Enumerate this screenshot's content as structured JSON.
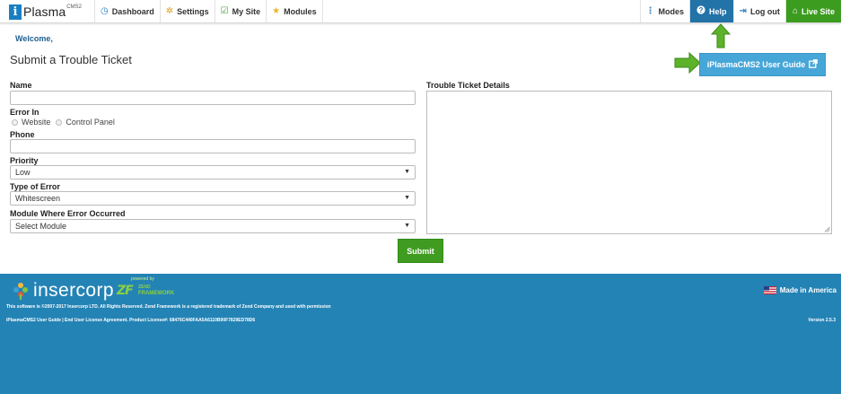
{
  "nav": {
    "brand_letter": "i",
    "brand_name": "Plasma",
    "brand_sup": "CMS2",
    "left_items": [
      {
        "icon": "dashboard-icon",
        "glyph": "◷",
        "label": "Dashboard"
      },
      {
        "icon": "settings-icon",
        "glyph": "✲",
        "label": "Settings"
      },
      {
        "icon": "edit-icon",
        "glyph": "☑",
        "label": "My Site"
      },
      {
        "icon": "star-icon",
        "glyph": "★",
        "label": "Modules"
      }
    ],
    "right_items": {
      "modes": {
        "glyph": "⋮",
        "label": "Modes"
      },
      "help": {
        "glyph": "❓",
        "label": "Help"
      },
      "logout": {
        "glyph": "⇥",
        "label": "Log out"
      },
      "live": {
        "glyph": "⌂",
        "label": "Live Site"
      }
    }
  },
  "page": {
    "welcome": "Welcome,",
    "title": "Submit a Trouble Ticket",
    "guide_button": "iPlasmaCMS2 User Guide",
    "guide_icon": "external-link-icon"
  },
  "form": {
    "name_label": "Name",
    "error_in_label": "Error In",
    "error_in_options": [
      "Website",
      "Control Panel"
    ],
    "phone_label": "Phone",
    "priority_label": "Priority",
    "priority_value": "Low",
    "type_label": "Type of Error",
    "type_value": "Whitescreen",
    "module_label": "Module Where Error Occurred",
    "module_value": "Select Module",
    "details_label": "Trouble Ticket Details",
    "submit": "Submit"
  },
  "footer": {
    "logo_text": "insercorp",
    "zf_powered": "powered by",
    "zf_mark": "ZF",
    "zf_word1": "ZEND",
    "zf_word2": "FRAMEWORK",
    "made_in": "Made in America",
    "copyright": "This software is ©2007-2017 Insercorp LTD. All Rights Reserved. Zend Framework is a registered trademark of Zend Company and used with permission",
    "links": "iPlasmaCMS2 User Guide | End User License Agreement. Product License#: 68476C440FAA5A6110B90F7829ED78D6",
    "version": "Version 2.5.3"
  },
  "colors": {
    "primary_blue": "#2483b5",
    "help_blue": "#2173a8",
    "guide_blue": "#47a6d8",
    "green": "#3c9c20",
    "arrow_green": "#5cb32a"
  }
}
